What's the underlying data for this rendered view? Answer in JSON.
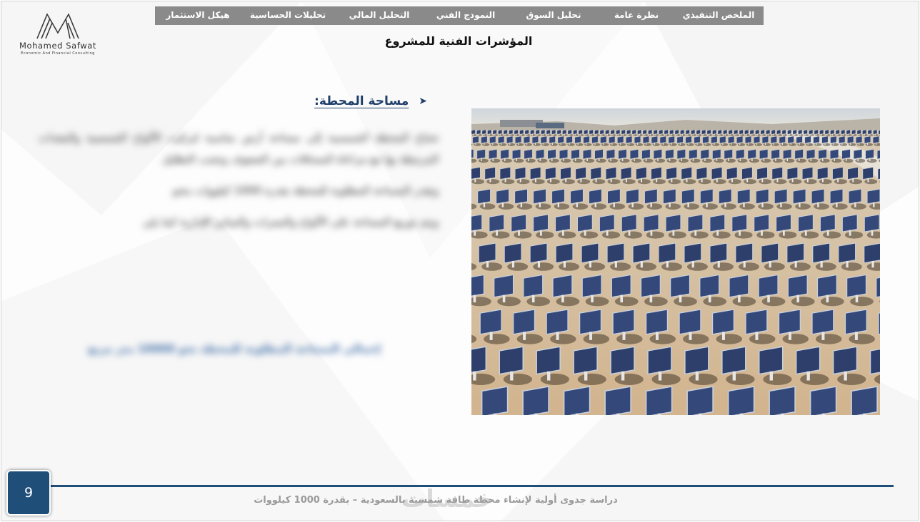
{
  "logo": {
    "name": "Mohamed Safwat",
    "tagline": "Economic And Financial Consulting"
  },
  "nav": {
    "items": [
      {
        "label": "الملخص التنفيذي"
      },
      {
        "label": "نظرة عامة"
      },
      {
        "label": "تحليل السوق"
      },
      {
        "label": "النموذج الفني"
      },
      {
        "label": "التحليل المالي"
      },
      {
        "label": "تحليلات الحساسية"
      },
      {
        "label": "هيكل الاستثمار"
      }
    ]
  },
  "page_title": "المؤشرات الفنية للمشروع",
  "section": {
    "title": "مساحة المحطة:",
    "icon": "arrow-bullet-icon"
  },
  "body": {
    "paragraphs": [
      "تحتاج المحطة الشمسية إلى مساحة أرض مناسبة لتركيب الألواح الشمسية والمعدات المرتبطة بها مع مراعاة المسافات بين الصفوف وتجنب التظليل",
      "وتقدر المساحة المطلوبة للمحطة بقدرة 1000 كيلووات بنحو",
      "ويتم توزيع المساحة على الألواح والممرات والمباني الإدارية كما يلي"
    ],
    "highlight": "إجمالي المساحة المطلوبة للمحطة نحو 10000 متر مربع"
  },
  "photo": {
    "description_icon": "solar-farm-image"
  },
  "footer": {
    "page_number": "9",
    "text": "دراسة جدوى أولية لإنشاء محطة طاقة شمسية بالسعودية – بقدرة 1000 كيلووات",
    "watermark": "خمسات"
  },
  "colors": {
    "nav_bg": "#8a8a8a",
    "accent": "#1f4e79",
    "heading": "#1f3f6a"
  }
}
